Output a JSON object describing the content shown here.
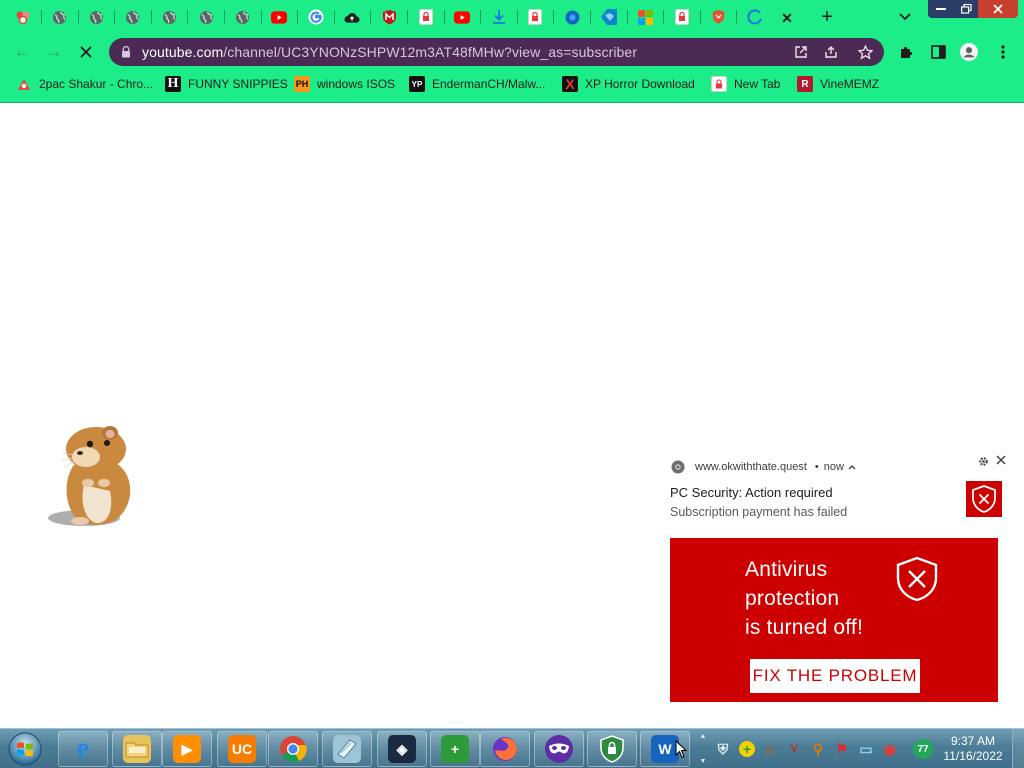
{
  "colors": {
    "theme": "#1ced88",
    "omnibox": "#4b2a54",
    "alert_red": "#cc0000",
    "taskbar": "#4c7d97"
  },
  "browser": {
    "tabs": [
      {
        "icon": "people-red-icon",
        "color": "#e7453d"
      },
      {
        "icon": "globe-icon",
        "color": "#5f6368"
      },
      {
        "icon": "globe-icon",
        "color": "#5f6368"
      },
      {
        "icon": "globe-icon",
        "color": "#5f6368"
      },
      {
        "icon": "globe-icon",
        "color": "#5f6368"
      },
      {
        "icon": "globe-icon",
        "color": "#5f6368"
      },
      {
        "icon": "globe-icon",
        "color": "#5f6368"
      },
      {
        "icon": "youtube-icon",
        "color": "#ff0000"
      },
      {
        "icon": "google-icon",
        "color": "#4285f4"
      },
      {
        "icon": "cloud-upload-icon",
        "color": "#202124"
      },
      {
        "icon": "mcafee-icon",
        "color": "#c01818"
      },
      {
        "icon": "padlock-page-icon",
        "color": "#ffffff"
      },
      {
        "icon": "youtube-icon",
        "color": "#ff0000"
      },
      {
        "icon": "download-icon",
        "color": "#1a73e8"
      },
      {
        "icon": "padlock-page-icon",
        "color": "#ffffff"
      },
      {
        "icon": "blue-circle-icon",
        "color": "#1565c0"
      },
      {
        "icon": "windows-blue-icon",
        "color": "#0a86d0"
      },
      {
        "icon": "microsoft-icon",
        "color": "#f25022"
      },
      {
        "icon": "padlock-page-icon",
        "color": "#ffffff"
      },
      {
        "icon": "brave-icon",
        "color": "#e8512a"
      },
      {
        "icon": "loading-spinner-icon",
        "color": "#1a73e8"
      }
    ],
    "active_tab_close": "✕",
    "new_tab": "+",
    "url_host": "youtube.com",
    "url_path": "/channel/UC3YNONzSHPW12m3AT48fMHw?view_as=subscriber",
    "bookmarks": [
      {
        "label": "2pac Shakur - Chro...",
        "icon": "bookmark-2pac-icon",
        "color": "#e7453d",
        "glyph": ""
      },
      {
        "label": "FUNNY SNIPPIES",
        "icon": "bookmark-h-icon",
        "color": "#111111",
        "glyph": "H"
      },
      {
        "label": "windows ISOS",
        "icon": "bookmark-ph-icon",
        "color": "#f7971d",
        "glyph": "PH"
      },
      {
        "label": "EndermanCH/Malw...",
        "icon": "bookmark-yp-icon",
        "color": "#111111",
        "glyph": "YP"
      },
      {
        "label": "XP Horror Download",
        "icon": "bookmark-x-icon",
        "color": "#111111",
        "glyph": "X"
      },
      {
        "label": "New Tab",
        "icon": "bookmark-padlock-icon",
        "color": "#ffffff",
        "glyph": ""
      },
      {
        "label": "VineMEMZ",
        "icon": "bookmark-r-icon",
        "color": "#b3192c",
        "glyph": "R"
      }
    ]
  },
  "notification": {
    "site": "www.okwiththate.quest",
    "time": "now",
    "title": "PC Security: Action required",
    "body": "Subscription payment has failed",
    "image_lines": [
      "Antivirus",
      "protection",
      "is turned off!"
    ],
    "button": "FIX THE PROBLEM"
  },
  "taskbar": {
    "apps": [
      {
        "name": "taskbar-internet-explorer",
        "icon": "internet-explorer-icon",
        "color": "#1e88e5",
        "glyph": "e"
      },
      {
        "name": "taskbar-file-explorer",
        "icon": "folder-icon",
        "color": "#e8c25a",
        "glyph": ""
      },
      {
        "name": "taskbar-media-player",
        "icon": "media-player-icon",
        "color": "#ff8f00",
        "glyph": "▶"
      },
      {
        "name": "taskbar-uc-browser",
        "icon": "uc-browser-icon",
        "color": "#f57c00",
        "glyph": "UC"
      },
      {
        "name": "taskbar-chrome",
        "icon": "chrome-icon",
        "color": "#db4437",
        "glyph": ""
      },
      {
        "name": "taskbar-notepad",
        "icon": "notepad-icon",
        "color": "#9ec5d6",
        "glyph": ""
      },
      {
        "name": "taskbar-3d-app",
        "icon": "cube-icon",
        "color": "#1a2a40",
        "glyph": "◈"
      },
      {
        "name": "taskbar-plus-app",
        "icon": "green-plus-icon",
        "color": "#2e9b3a",
        "glyph": "+"
      },
      {
        "name": "taskbar-firefox",
        "icon": "firefox-icon",
        "color": "#ff7139",
        "glyph": ""
      },
      {
        "name": "taskbar-mask-app",
        "icon": "purple-mask-icon",
        "color": "#5e2ca5",
        "glyph": ""
      },
      {
        "name": "taskbar-shield-app",
        "icon": "shield-lock-icon",
        "color": "#2c8a3e",
        "glyph": ""
      },
      {
        "name": "taskbar-w-app",
        "icon": "w-app-icon",
        "color": "#1565c0",
        "glyph": "W"
      }
    ],
    "tray": [
      {
        "icon": "defender-shield-icon",
        "color": "#4a7da0",
        "glyph": "⛨"
      },
      {
        "icon": "tray-plus-icon",
        "color": "#2e9b3a",
        "glyph": "+"
      },
      {
        "icon": "tray-device-icon",
        "color": "#707070",
        "glyph": "▦"
      },
      {
        "icon": "tray-v-icon",
        "color": "#c62828",
        "glyph": "V"
      },
      {
        "icon": "tray-search-icon",
        "color": "#e07b00",
        "glyph": "⚲"
      },
      {
        "icon": "tray-flag-icon",
        "color": "#d32f2f",
        "glyph": "⚑"
      },
      {
        "icon": "tray-monitor-icon",
        "color": "#1e88e5",
        "glyph": "▭"
      },
      {
        "icon": "tray-record-icon",
        "color": "#333333",
        "glyph": "◉"
      },
      {
        "icon": "tray-counter-icon",
        "color": "#23a85a",
        "glyph": "77"
      }
    ],
    "time": "9:37 AM",
    "date": "11/16/2022"
  }
}
